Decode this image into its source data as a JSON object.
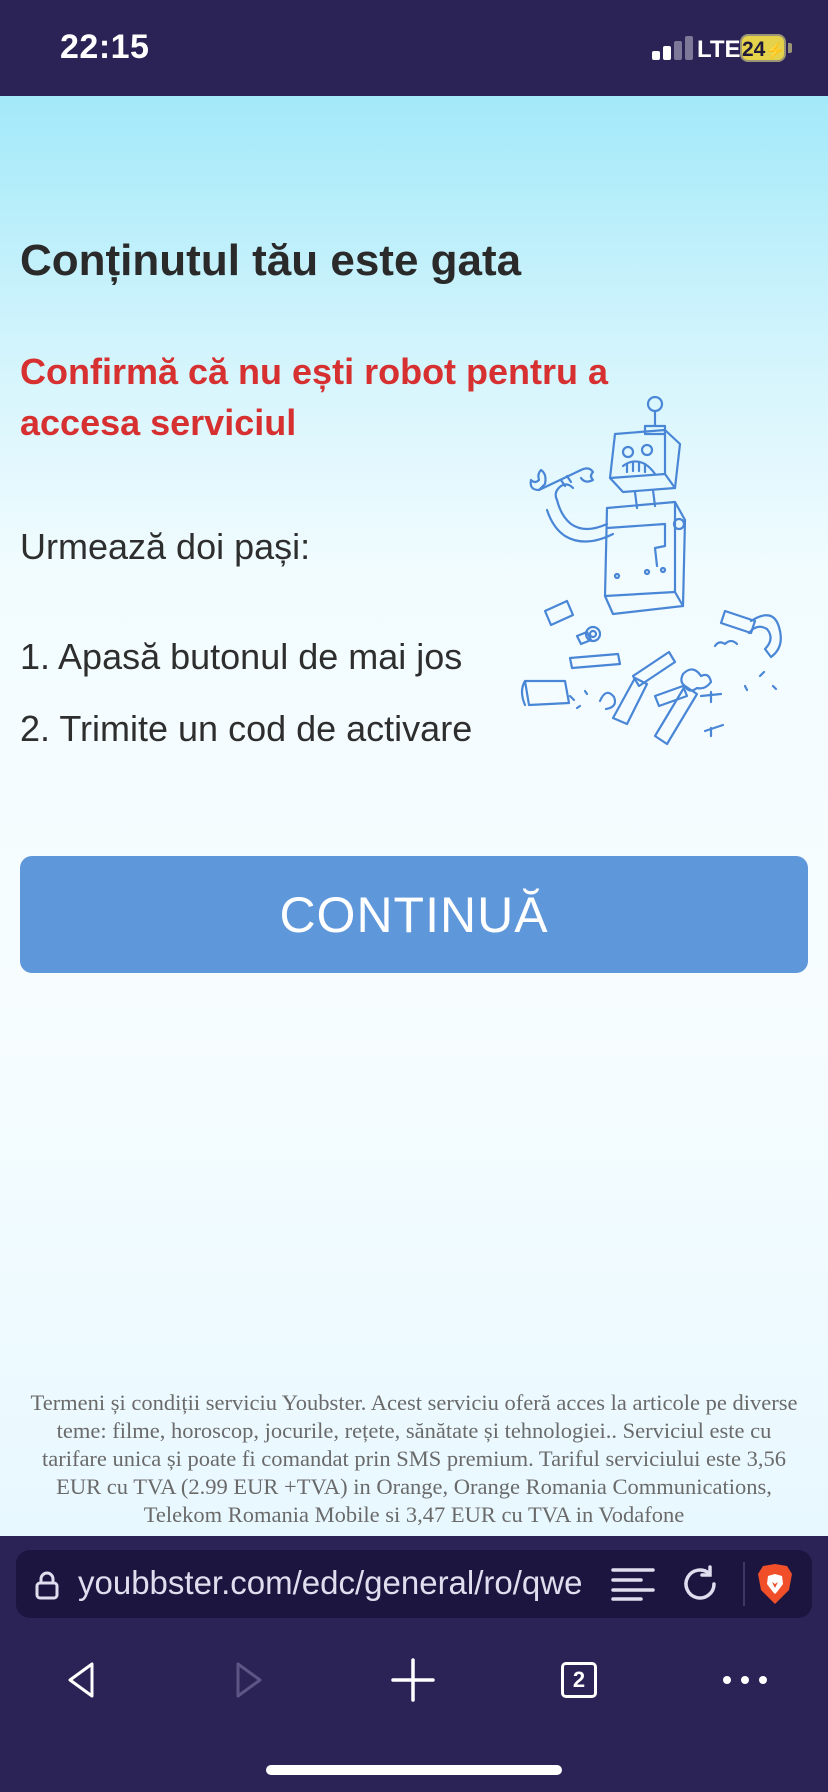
{
  "status_bar": {
    "time": "22:15",
    "network": "LTE",
    "battery": "24",
    "icons": [
      "signal-icon",
      "battery-charging-icon"
    ]
  },
  "page": {
    "title": "Conținutul tău este gata",
    "confirm": "Confirmă că nu ești robot pentru a accesa serviciul",
    "steps_intro": "Urmează doi pași:",
    "steps": [
      "1. Apasă butonul de mai jos",
      "2. Trimite un cod de activare"
    ],
    "continue_label": "CONTINUĂ",
    "terms": "Termeni și condiții serviciu Youbster. Acest serviciu oferă acces la articole pe diverse teme: filme, horoscop, jocurile, rețete, sănătate și tehnologiei.. Serviciul este cu tarifare unica și poate fi comandat prin SMS premium. Tariful serviciului este 3,56 EUR cu TVA (2.99 EUR +TVA) in Orange, Orange Romania Communications, Telekom Romania Mobile si 3,47 EUR cu TVA in Vodafone",
    "illustration": "broken-robot-illustration"
  },
  "browser": {
    "url": "youbbster.com/edc/general/ro/qwe",
    "tab_count": "2",
    "icons": [
      "lock-icon",
      "reader-mode-icon",
      "reload-icon",
      "brave-shield-icon",
      "back-icon",
      "forward-icon",
      "new-tab-icon",
      "tabs-icon",
      "more-icon"
    ]
  },
  "colors": {
    "system_bar": "#2b2255",
    "button": "#5f97db",
    "confirm_text": "#d63030",
    "title_text": "#2a2a2a",
    "illustration_stroke": "#4a86d6"
  }
}
